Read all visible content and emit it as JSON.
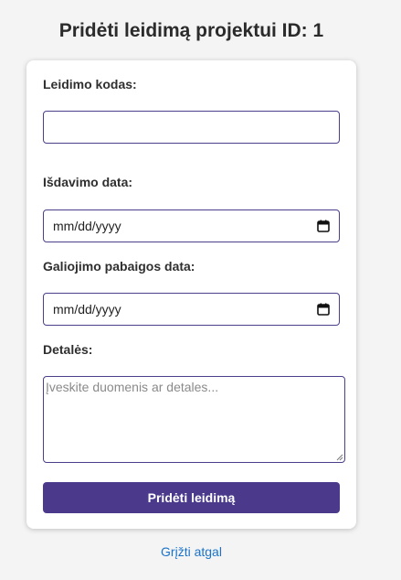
{
  "page": {
    "title": "Pridėti leidimą projektui ID: 1"
  },
  "form": {
    "code_label": "Leidimo kodas:",
    "code_value": "",
    "issue_date_label": "Išdavimo data:",
    "issue_date_value": "mm/dd/yyyy",
    "expiry_date_label": "Galiojimo pabaigos data:",
    "expiry_date_value": "mm/dd/yyyy",
    "details_label": "Detalės:",
    "details_placeholder": "Įveskite duomenis ar detales...",
    "submit_label": "Pridėti leidimą"
  },
  "footer": {
    "back_link": "Grįžti atgal"
  },
  "icons": {
    "date_picker": "calendar-icon"
  },
  "colors": {
    "accent": "#4b3a8c",
    "field_border": "#4b3f8a",
    "link": "#1a73c9",
    "background": "#f4f4f4"
  }
}
